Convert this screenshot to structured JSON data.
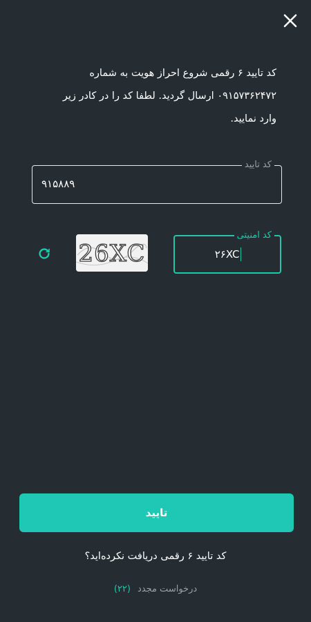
{
  "close": {
    "icon": "close-icon"
  },
  "message": {
    "line1": "کد تایید ۶ رقمی شروع احراز هویت به شماره",
    "line2": "۰۹۱۵۷۳۶۲۴۷۲ ارسال گردید. لطفا کد را در کادر زیر",
    "line3": "وارد نمایید."
  },
  "code_field": {
    "label": "کد تایید",
    "value": "۹۱۵۸۸۹"
  },
  "security_field": {
    "label": "کد امنیتی",
    "value": "۲۶XC"
  },
  "captcha": {
    "text": "26XC",
    "icon": "captcha-image"
  },
  "refresh": {
    "icon": "refresh-icon"
  },
  "confirm_button": {
    "label": "تایید"
  },
  "not_received": {
    "text": "کد تایید ۶ رقمی دریافت نکرده‌اید؟"
  },
  "resend": {
    "label": "درخواست مجدد",
    "countdown": "(۲۲)"
  },
  "colors": {
    "background": "#252d33",
    "accent": "#1fc7b5",
    "text": "#ffffff",
    "muted": "#9aa1a6"
  }
}
